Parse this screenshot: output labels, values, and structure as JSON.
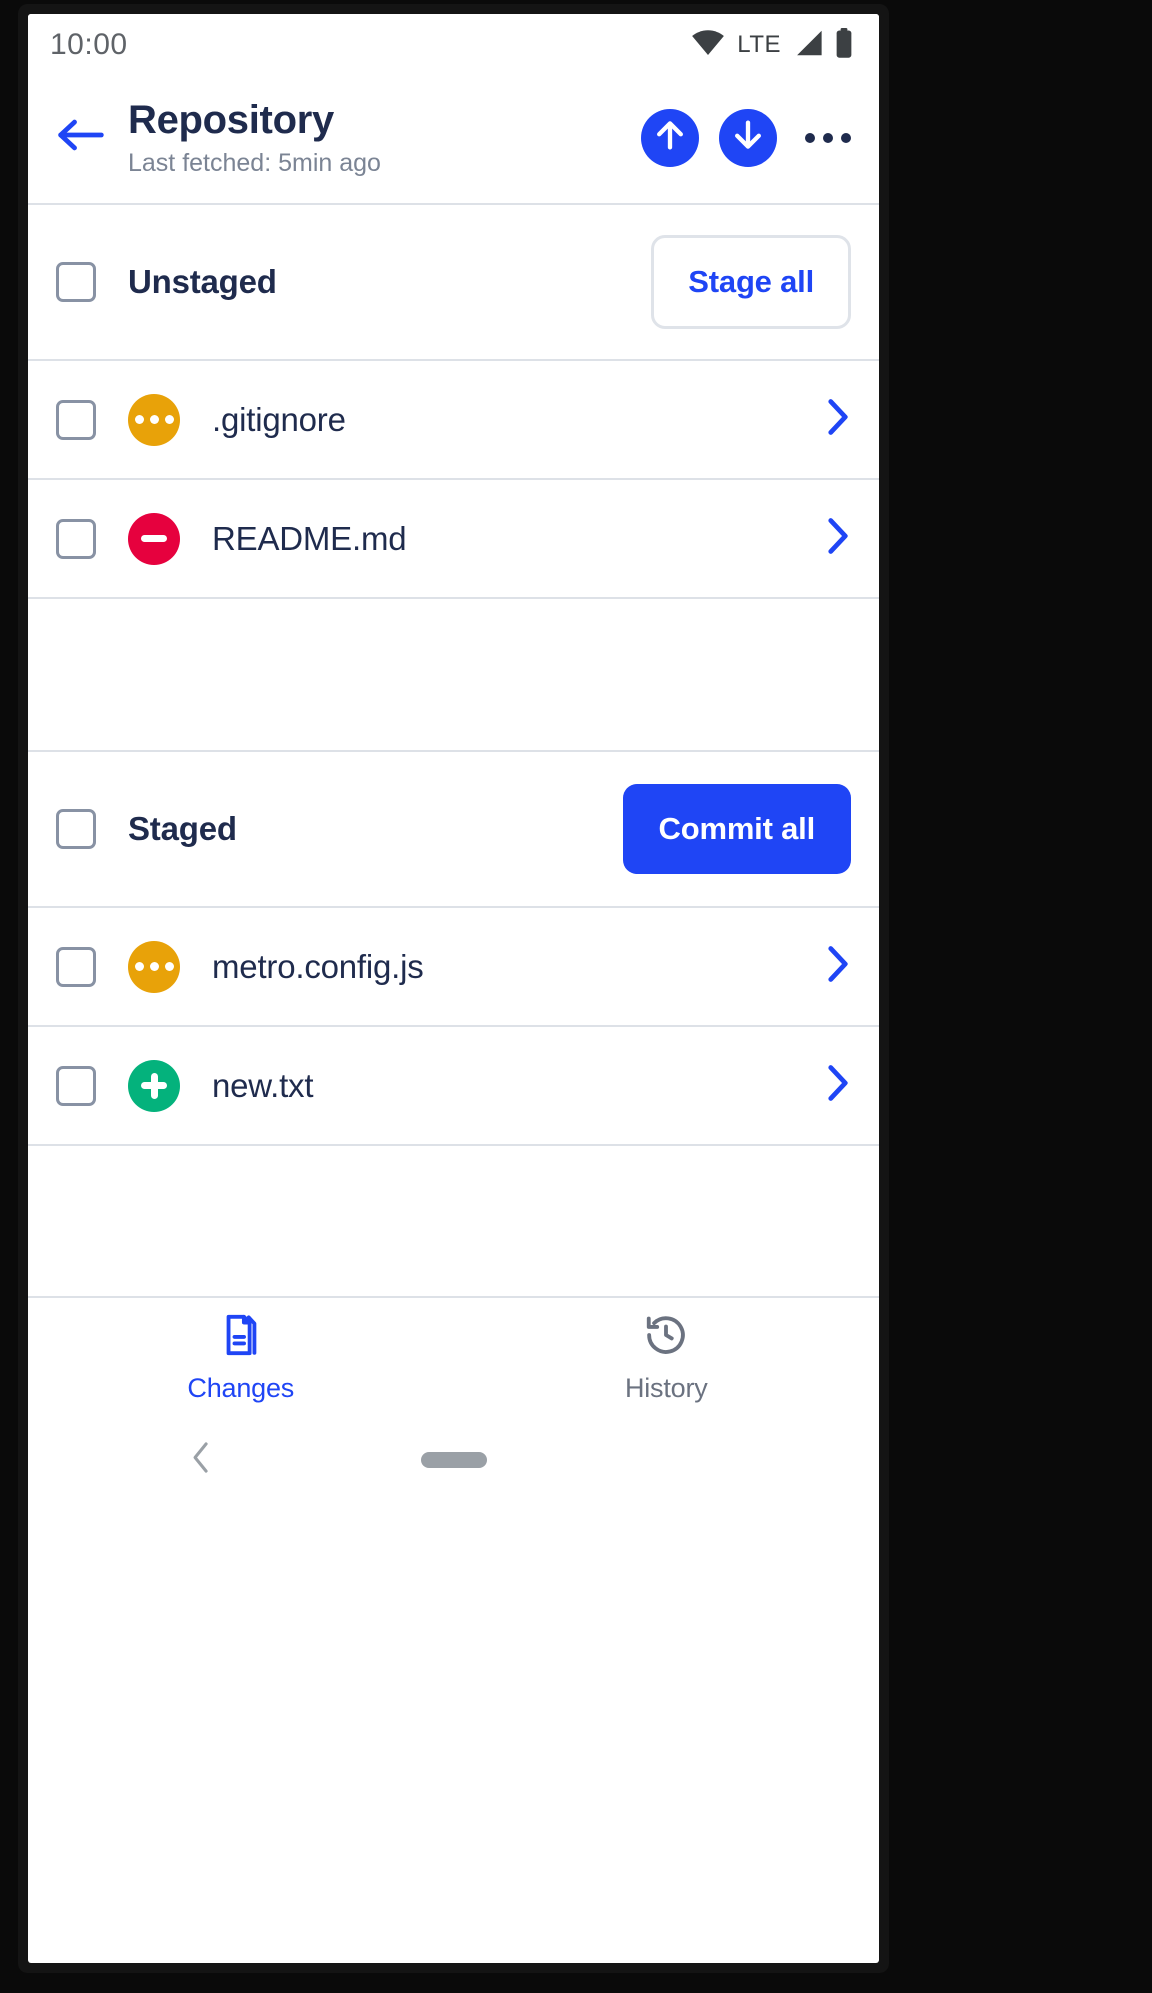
{
  "status_bar": {
    "time": "10:00",
    "network_label": "LTE",
    "icons": [
      "wifi-icon",
      "signal-icon",
      "battery-icon"
    ]
  },
  "app_bar": {
    "back_icon": "arrow-left-icon",
    "title": "Repository",
    "subtitle": "Last fetched: 5min ago",
    "actions": [
      {
        "name": "push-button",
        "icon": "arrow-up-icon"
      },
      {
        "name": "pull-button",
        "icon": "arrow-down-icon"
      },
      {
        "name": "overflow-menu-button",
        "icon": "more-horizontal-icon"
      }
    ]
  },
  "sections": [
    {
      "id": "unstaged",
      "title": "Unstaged",
      "checked": false,
      "action_label": "Stage all",
      "action_style": "outline",
      "files": [
        {
          "name": ".gitignore",
          "status": "modified",
          "status_icon": "dots-circle-icon",
          "checked": false
        },
        {
          "name": "README.md",
          "status": "deleted",
          "status_icon": "minus-circle-icon",
          "checked": false
        }
      ]
    },
    {
      "id": "staged",
      "title": "Staged",
      "checked": false,
      "action_label": "Commit all",
      "action_style": "filled",
      "files": [
        {
          "name": "metro.config.js",
          "status": "modified",
          "status_icon": "dots-circle-icon",
          "checked": false
        },
        {
          "name": "new.txt",
          "status": "added",
          "status_icon": "plus-circle-icon",
          "checked": false
        }
      ]
    }
  ],
  "tabs": [
    {
      "label": "Changes",
      "icon": "file-document-icon",
      "active": true
    },
    {
      "label": "History",
      "icon": "clock-history-icon",
      "active": false
    }
  ],
  "colors": {
    "accent_blue": "#1f45f5",
    "title_navy": "#1f2b4d",
    "subtle_gray": "#7b8494",
    "divider": "#dde1e7",
    "status_modified": "#e8a209",
    "status_deleted": "#e6013e",
    "status_added": "#04b27c"
  }
}
